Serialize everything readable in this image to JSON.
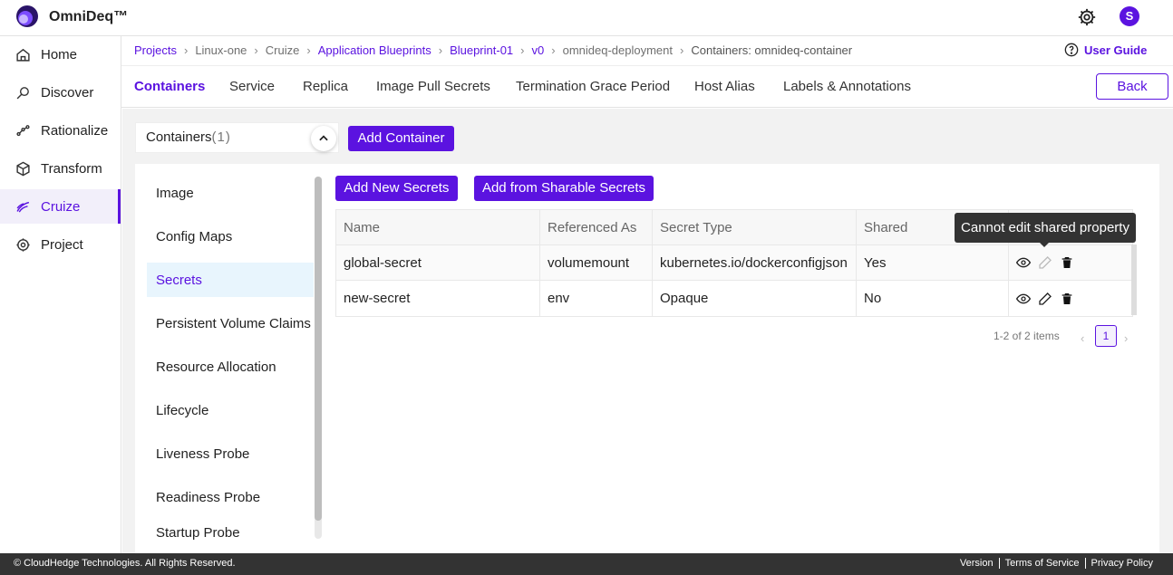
{
  "app": {
    "title": "OmniDeq™",
    "avatar_letter": "S",
    "accent": "#5b13e0"
  },
  "sidebar": {
    "items": [
      {
        "label": "Home",
        "icon": "home-icon"
      },
      {
        "label": "Discover",
        "icon": "discover-icon"
      },
      {
        "label": "Rationalize",
        "icon": "rationalize-icon"
      },
      {
        "label": "Transform",
        "icon": "transform-icon"
      },
      {
        "label": "Cruize",
        "icon": "cruize-icon",
        "active": true
      },
      {
        "label": "Project",
        "icon": "project-icon"
      }
    ]
  },
  "breadcrumb": {
    "items": [
      {
        "label": "Projects",
        "link": true
      },
      {
        "label": "Linux-one",
        "link": false
      },
      {
        "label": "Cruize",
        "link": false
      },
      {
        "label": "Application Blueprints",
        "link": true
      },
      {
        "label": "Blueprint-01",
        "link": true
      },
      {
        "label": "v0",
        "link": true
      },
      {
        "label": "omnideq-deployment",
        "link": false
      },
      {
        "label": "Containers: omnideq-container",
        "link": false
      }
    ],
    "user_guide": "User Guide"
  },
  "tabs": {
    "items": [
      {
        "label": "Containers",
        "active": true
      },
      {
        "label": "Service"
      },
      {
        "label": "Replica"
      },
      {
        "label": "Image Pull Secrets"
      },
      {
        "label": "Termination Grace Period"
      },
      {
        "label": "Host Alias"
      },
      {
        "label": "Labels & Annotations"
      }
    ],
    "back_label": "Back"
  },
  "containers": {
    "label": "Containers",
    "count": "(1)",
    "add_label": "Add Container"
  },
  "menu": {
    "items": [
      {
        "label": "Image"
      },
      {
        "label": "Config Maps"
      },
      {
        "label": "Secrets",
        "active": true
      },
      {
        "label": "Persistent Volume Claims"
      },
      {
        "label": "Resource Allocation"
      },
      {
        "label": "Lifecycle"
      },
      {
        "label": "Liveness Probe"
      },
      {
        "label": "Readiness Probe"
      },
      {
        "label": "Startup Probe"
      }
    ]
  },
  "secrets": {
    "add_new_label": "Add New Secrets",
    "add_shared_label": "Add from Sharable Secrets",
    "columns": [
      "Name",
      "Referenced As",
      "Secret Type",
      "Shared"
    ],
    "rows": [
      {
        "name": "global-secret",
        "referenced_as": "volumemount",
        "secret_type": "kubernetes.io/dockerconfigjson",
        "shared": "Yes"
      },
      {
        "name": "new-secret",
        "referenced_as": "env",
        "secret_type": "Opaque",
        "shared": "No"
      }
    ],
    "tooltip": "Cannot edit shared property",
    "pager_info": "1-2 of 2 items",
    "current_page": "1",
    "prev_glyph": "‹",
    "next_glyph": "›"
  },
  "footer": {
    "copyright": "© CloudHedge Technologies. All Rights Reserved.",
    "links": [
      "Version",
      "Terms of Service",
      "Privacy Policy"
    ]
  }
}
